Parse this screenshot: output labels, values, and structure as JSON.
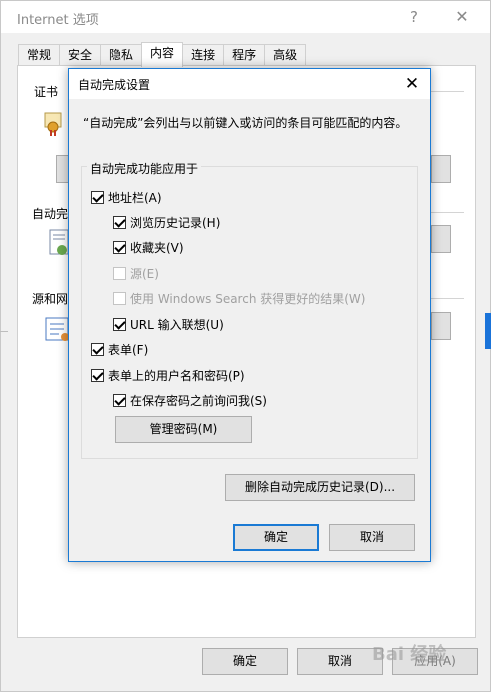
{
  "outer_window": {
    "title": "Internet 选项",
    "help_glyph": "?",
    "close_glyph": "✕",
    "tabs": [
      "常规",
      "安全",
      "隐私",
      "内容",
      "连接",
      "程序",
      "高级"
    ],
    "active_tab_index": 3,
    "groups": {
      "certificates_label": "证书",
      "autocomplete_label": "自动完",
      "feeds_label": "源和网"
    },
    "footer": {
      "ok_label": "确定",
      "cancel_label": "取消",
      "apply_label": "应用(A)"
    }
  },
  "dialog": {
    "title": "自动完成设置",
    "close_glyph": "✕",
    "description": "“自动完成”会列出与以前键入或访问的条目可能匹配的内容。",
    "fieldset_legend": "自动完成功能应用于",
    "options": [
      {
        "label": "地址栏(A)",
        "checked": true,
        "disabled": false,
        "indent": 0
      },
      {
        "label": "浏览历史记录(H)",
        "checked": true,
        "disabled": false,
        "indent": 1
      },
      {
        "label": "收藏夹(V)",
        "checked": true,
        "disabled": false,
        "indent": 1
      },
      {
        "label": "源(E)",
        "checked": false,
        "disabled": true,
        "indent": 1
      },
      {
        "label": "使用 Windows Search 获得更好的结果(W)",
        "checked": false,
        "disabled": true,
        "indent": 1
      },
      {
        "label": "URL 输入联想(U)",
        "checked": true,
        "disabled": false,
        "indent": 1
      },
      {
        "label": "表单(F)",
        "checked": true,
        "disabled": false,
        "indent": 0
      },
      {
        "label": "表单上的用户名和密码(P)",
        "checked": true,
        "disabled": false,
        "indent": 0
      },
      {
        "label": "在保存密码之前询问我(S)",
        "checked": true,
        "disabled": false,
        "indent": 1
      }
    ],
    "manage_passwords_label": "管理密码(M)",
    "delete_history_label": "删除自动完成历史记录(D)...",
    "ok_label": "确定",
    "cancel_label": "取消"
  },
  "watermark_text": "Bai 经验",
  "colors": {
    "accent": "#1a7ad4",
    "window_bg": "#f0f0f0",
    "button_bg": "#e1e1e1"
  }
}
